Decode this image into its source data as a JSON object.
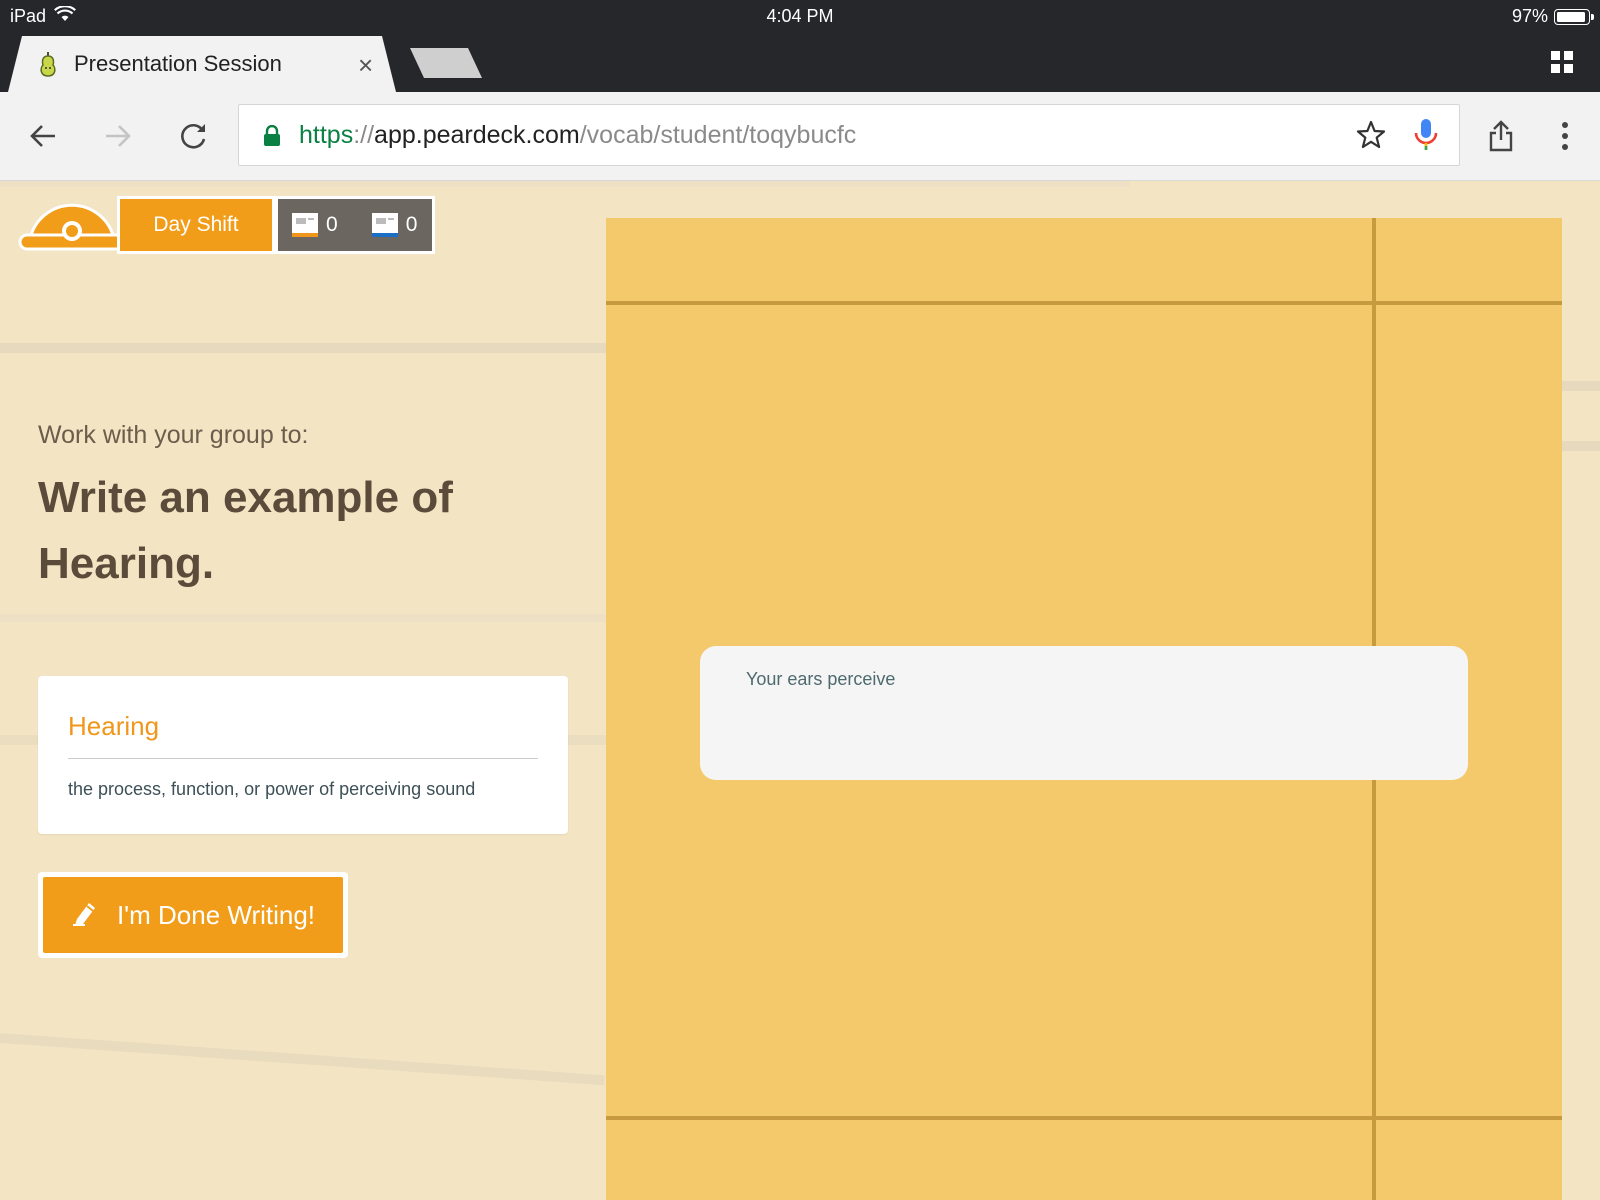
{
  "status_bar": {
    "device": "iPad",
    "time": "4:04 PM",
    "battery_text": "97%",
    "battery_level": 0.97
  },
  "browser": {
    "tab_title": "Presentation Session",
    "tab_close": "×",
    "url": {
      "scheme": "https",
      "separator": "://",
      "host": "app.peardeck.com",
      "path": "/vocab/student/toqybucfc"
    }
  },
  "session": {
    "shift_label": "Day Shift",
    "count_a": "0",
    "count_b": "0",
    "count_a_color": "#f0971b",
    "count_b_color": "#1a6fc4"
  },
  "prompt": {
    "label": "Work with your group to:",
    "title": "Write an example of Hearing."
  },
  "definition": {
    "word": "Hearing",
    "text": "the process, function, or power of perceiving sound"
  },
  "done_button": {
    "label": "I'm Done Writing!"
  },
  "answer": {
    "text": "Your ears perceive"
  },
  "colors": {
    "accent": "#f19d1a",
    "board": "#f4c96c",
    "background": "#f3e4c4",
    "chrome": "#26272b"
  }
}
